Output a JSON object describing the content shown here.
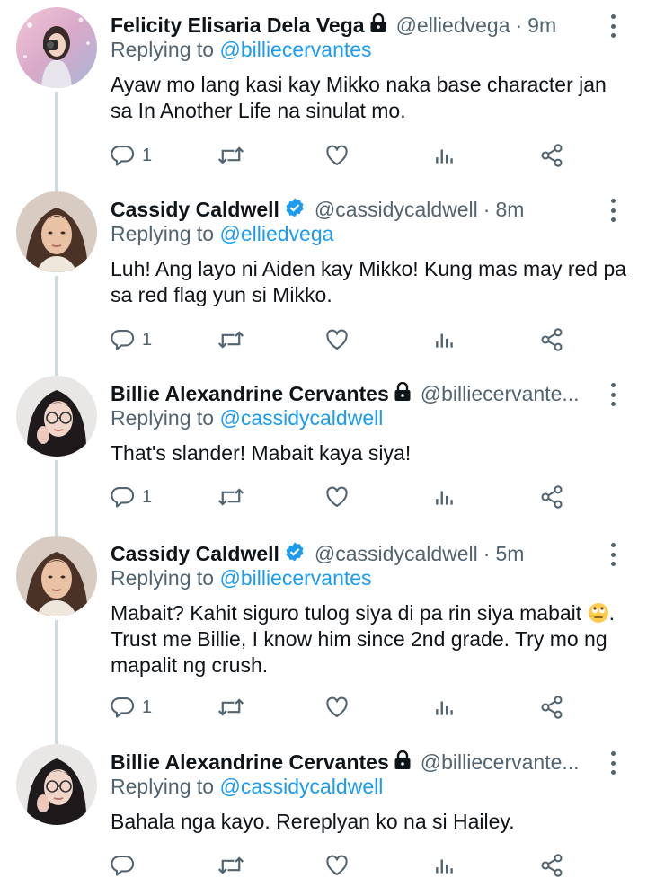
{
  "tweets": [
    {
      "name": "Felicity Elisaria Dela Vega",
      "protected": true,
      "verified": false,
      "handle": "@elliedvega",
      "time": "9m",
      "replying_label": "Replying to",
      "replying_to": "@billiecervantes",
      "text_before": "Ayaw mo lang kasi kay Mikko naka base character jan sa In Another Life na sinulat mo.",
      "text_after": "",
      "reply_count": "1",
      "avatar": "felicity-avatar"
    },
    {
      "name": "Cassidy Caldwell",
      "protected": false,
      "verified": true,
      "handle": "@cassidycaldwell",
      "time": "8m",
      "replying_label": "Replying to",
      "replying_to": "@elliedvega",
      "text_before": "Luh! Ang layo ni Aiden kay Mikko! Kung mas may red pa sa red flag yun si Mikko.",
      "text_after": "",
      "reply_count": "1",
      "avatar": "cassidy-avatar"
    },
    {
      "name": "Billie Alexandrine Cervantes",
      "protected": true,
      "verified": false,
      "handle": "@billiecervante...",
      "time": "",
      "replying_label": "Replying to",
      "replying_to": "@cassidycaldwell",
      "text_before": "That's slander! Mabait kaya siya!",
      "text_after": "",
      "reply_count": "1",
      "avatar": "billie-avatar"
    },
    {
      "name": "Cassidy Caldwell",
      "protected": false,
      "verified": true,
      "handle": "@cassidycaldwell",
      "time": "5m",
      "replying_label": "Replying to",
      "replying_to": "@billiecervantes",
      "text_before": "Mabait? Kahit siguro tulog siya di pa rin siya mabait",
      "emoji": "face-with-rolling-eyes",
      "text_after": ". Trust me Billie, I know him since 2nd grade. Try mo ng mapalit ng crush.",
      "reply_count": "1",
      "avatar": "cassidy-avatar"
    },
    {
      "name": "Billie Alexandrine Cervantes",
      "protected": true,
      "verified": false,
      "handle": "@billiecervante...",
      "time": "",
      "replying_label": "Replying to",
      "replying_to": "@cassidycaldwell",
      "text_before": "Bahala nga kayo. Rereplyan ko na si Hailey.",
      "text_after": "",
      "reply_count": "",
      "avatar": "billie-avatar"
    }
  ],
  "icons": {
    "reply": "reply-icon",
    "retweet": "retweet-icon",
    "like": "like-icon",
    "views": "views-icon",
    "share": "share-icon",
    "more": "more-icon",
    "lock": "lock-icon",
    "verified": "verified-badge-icon"
  },
  "colors": {
    "accent": "#1d9bf0",
    "secondary_text": "#536471",
    "thread_line": "#cfd9de",
    "primary_text": "#0f1419"
  }
}
